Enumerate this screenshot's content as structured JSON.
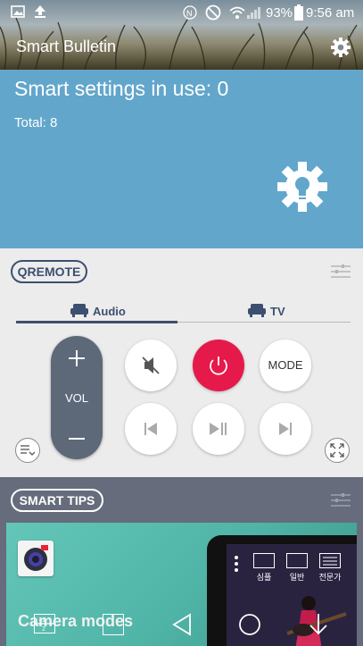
{
  "status_bar": {
    "battery_percent": "93%",
    "time": "9:56 am"
  },
  "header": {
    "title": "Smart Bulletin"
  },
  "smart_settings": {
    "heading": "Smart settings in use:  0",
    "total": "Total:  8"
  },
  "qremote": {
    "badge": "QREMOTE",
    "tabs": [
      {
        "label": "Audio",
        "active": true
      },
      {
        "label": "TV",
        "active": false
      }
    ],
    "vol_label": "VOL",
    "mode_label": "MODE",
    "power_color": "#e6194b"
  },
  "smart_tips": {
    "badge": "SMART TIPS",
    "card_title": "Camera modes",
    "phone_labels": [
      "심플",
      "일반",
      "전문가"
    ]
  },
  "colors": {
    "blue_panel": "#62a6cb",
    "tips_panel": "#666c7c",
    "accent_navy": "#3d4f70"
  }
}
